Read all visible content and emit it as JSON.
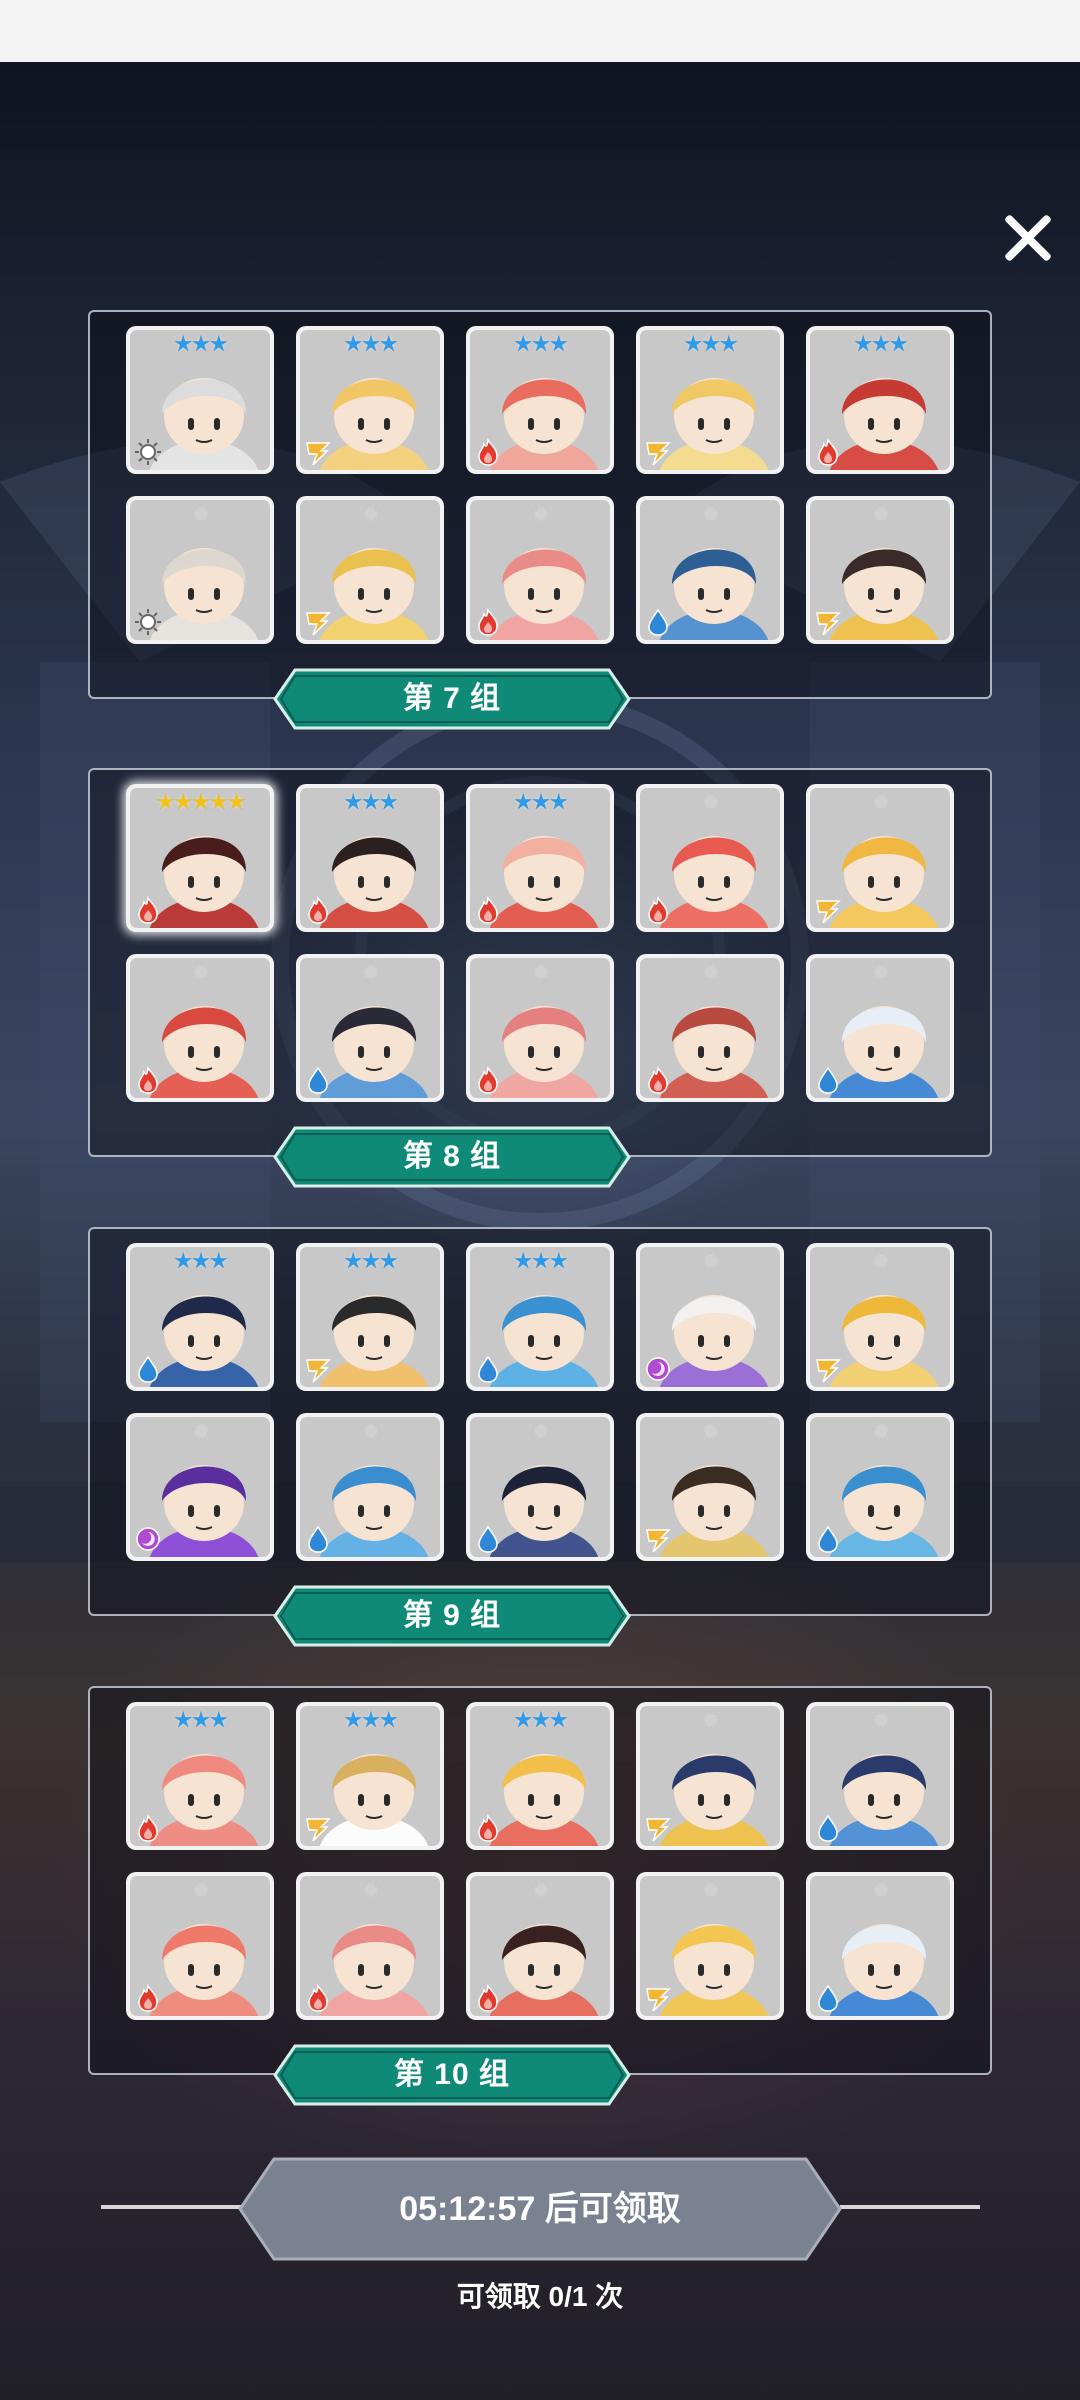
{
  "colors": {
    "label_fill": "#0f8a78",
    "label_border": "#0a5f53",
    "star_blue": "#2f9be8",
    "star_gray": "#d0d0d0",
    "star_gold": "#f2c21a",
    "button_fill": "#7a8190"
  },
  "element_icons": {
    "light": "sun-icon",
    "lightning": "lightning-icon",
    "fire": "fire-icon",
    "water": "water-drop-icon",
    "dark": "dark-swirl-icon"
  },
  "groups": [
    {
      "label": "第 7 组",
      "rows": [
        [
          {
            "stars": 3,
            "element": "light",
            "hue": "#e6e6e6",
            "hair": "#dcdcdc"
          },
          {
            "stars": 3,
            "element": "lightning",
            "hue": "#f5d27a",
            "hair": "#f1c766"
          },
          {
            "stars": 3,
            "element": "fire",
            "hue": "#f3a49a",
            "hair": "#e96c5f"
          },
          {
            "stars": 3,
            "element": "lightning",
            "hue": "#f6dc8c",
            "hair": "#f0c865"
          },
          {
            "stars": 3,
            "element": "fire",
            "hue": "#d8463e",
            "hair": "#c53a33"
          }
        ],
        [
          {
            "stars": 1,
            "element": "light",
            "hue": "#e8e4de",
            "hair": "#dcd8d0"
          },
          {
            "stars": 1,
            "element": "lightning",
            "hue": "#f3d36a",
            "hair": "#eac04f"
          },
          {
            "stars": 1,
            "element": "fire",
            "hue": "#f3a3a0",
            "hair": "#e98c88"
          },
          {
            "stars": 1,
            "element": "water",
            "hue": "#4f8fd0",
            "hair": "#2d5f95"
          },
          {
            "stars": 1,
            "element": "lightning",
            "hue": "#f0c24a",
            "hair": "#3a2a2a"
          }
        ]
      ]
    },
    {
      "label": "第 8 组",
      "rows": [
        [
          {
            "stars": 5,
            "element": "fire",
            "hue": "#b8332f",
            "hair": "#4a1d1d"
          },
          {
            "stars": 3,
            "element": "fire",
            "hue": "#d6483c",
            "hair": "#2b2020"
          },
          {
            "stars": 3,
            "element": "fire",
            "hue": "#e3584a",
            "hair": "#f2b0a0"
          },
          {
            "stars": 1,
            "element": "fire",
            "hue": "#ef6a5e",
            "hair": "#e85a50"
          },
          {
            "stars": 1,
            "element": "lightning",
            "hue": "#f6c85a",
            "hair": "#f0b842"
          }
        ],
        [
          {
            "stars": 1,
            "element": "fire",
            "hue": "#e85a4f",
            "hair": "#d84a40"
          },
          {
            "stars": 1,
            "element": "water",
            "hue": "#5b9ad8",
            "hair": "#2a2a36"
          },
          {
            "stars": 1,
            "element": "fire",
            "hue": "#f2a5a0",
            "hair": "#e58080"
          },
          {
            "stars": 1,
            "element": "fire",
            "hue": "#d25a4e",
            "hair": "#b84a40"
          },
          {
            "stars": 1,
            "element": "water",
            "hue": "#3f86d6",
            "hair": "#e8eef6"
          }
        ]
      ]
    },
    {
      "label": "第 9 组",
      "rows": [
        [
          {
            "stars": 3,
            "element": "water",
            "hue": "#2f5fa8",
            "hair": "#1f2a4a"
          },
          {
            "stars": 3,
            "element": "lightning",
            "hue": "#f2c06a",
            "hair": "#2a2a2a"
          },
          {
            "stars": 3,
            "element": "water",
            "hue": "#58b0e8",
            "hair": "#3a90d0"
          },
          {
            "stars": 1,
            "element": "dark",
            "hue": "#9a6ad8",
            "hair": "#f3f0f0"
          },
          {
            "stars": 1,
            "element": "lightning",
            "hue": "#f6d070",
            "hair": "#eeb83a"
          }
        ],
        [
          {
            "stars": 1,
            "element": "dark",
            "hue": "#8a4ad8",
            "hair": "#5a2e9e"
          },
          {
            "stars": 1,
            "element": "water",
            "hue": "#5fb0e8",
            "hair": "#3a8ed0"
          },
          {
            "stars": 1,
            "element": "water",
            "hue": "#3a4e8a",
            "hair": "#1e2238"
          },
          {
            "stars": 1,
            "element": "lightning",
            "hue": "#e6c66a",
            "hair": "#3a2c22"
          },
          {
            "stars": 1,
            "element": "water",
            "hue": "#62b6e6",
            "hair": "#3a8fcf"
          }
        ]
      ]
    },
    {
      "label": "第 10 组",
      "rows": [
        [
          {
            "stars": 3,
            "element": "fire",
            "hue": "#f08a80",
            "hair": "#f08a80"
          },
          {
            "stars": 3,
            "element": "lightning",
            "hue": "#ffffff",
            "hair": "#d8b060"
          },
          {
            "stars": 3,
            "element": "fire",
            "hue": "#ea6a5a",
            "hair": "#f2c04a"
          },
          {
            "stars": 1,
            "element": "lightning",
            "hue": "#f0c24a",
            "hair": "#2a3a6a"
          },
          {
            "stars": 1,
            "element": "water",
            "hue": "#4f8ed6",
            "hair": "#2a3a6a"
          }
        ],
        [
          {
            "stars": 1,
            "element": "fire",
            "hue": "#f08a7a",
            "hair": "#f07a6a"
          },
          {
            "stars": 1,
            "element": "fire",
            "hue": "#f3a3a0",
            "hair": "#e98c88"
          },
          {
            "stars": 1,
            "element": "fire",
            "hue": "#e86a5a",
            "hair": "#3a2020"
          },
          {
            "stars": 1,
            "element": "lightning",
            "hue": "#f2c650",
            "hair": "#f2c650"
          },
          {
            "stars": 1,
            "element": "water",
            "hue": "#3f86d6",
            "hair": "#e8eef6"
          }
        ]
      ]
    }
  ],
  "claim": {
    "timer_label": "05:12:57 后可领取",
    "count_label": "可领取 0/1 次"
  }
}
